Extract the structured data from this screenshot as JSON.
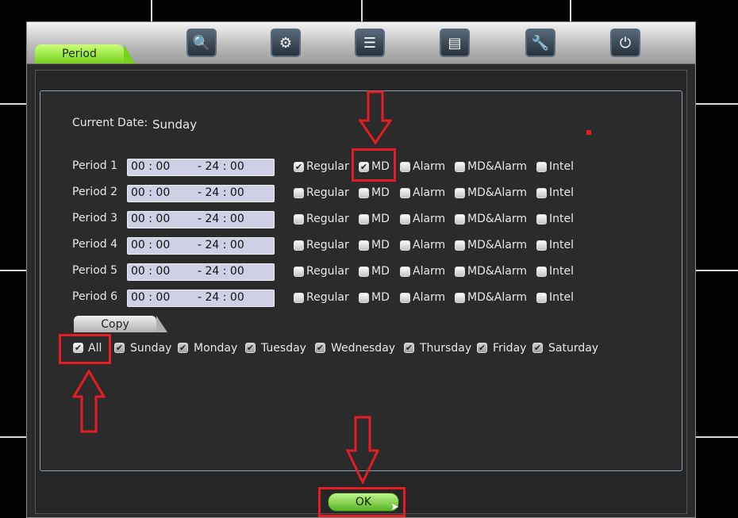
{
  "tab_title": "Period",
  "toolbar_icons": [
    "search-icon",
    "camera-settings-icon",
    "list-icon",
    "disk-icon",
    "wrench-icon",
    "power-icon"
  ],
  "current_date": {
    "label": "Current Date:",
    "value": "Sunday"
  },
  "periods": [
    {
      "label": "Period 1",
      "start": "00 : 00",
      "end": "- 24 : 00",
      "regular": true,
      "md": true,
      "alarm": false,
      "md_alarm": false,
      "intel": false
    },
    {
      "label": "Period 2",
      "start": "00 : 00",
      "end": "- 24 : 00",
      "regular": false,
      "md": false,
      "alarm": false,
      "md_alarm": false,
      "intel": false
    },
    {
      "label": "Period 3",
      "start": "00 : 00",
      "end": "- 24 : 00",
      "regular": false,
      "md": false,
      "alarm": false,
      "md_alarm": false,
      "intel": false
    },
    {
      "label": "Period 4",
      "start": "00 : 00",
      "end": "- 24 : 00",
      "regular": false,
      "md": false,
      "alarm": false,
      "md_alarm": false,
      "intel": false
    },
    {
      "label": "Period 5",
      "start": "00 : 00",
      "end": "- 24 : 00",
      "regular": false,
      "md": false,
      "alarm": false,
      "md_alarm": false,
      "intel": false
    },
    {
      "label": "Period 6",
      "start": "00 : 00",
      "end": "- 24 : 00",
      "regular": false,
      "md": false,
      "alarm": false,
      "md_alarm": false,
      "intel": false
    }
  ],
  "options": {
    "regular": "Regular",
    "md": "MD",
    "alarm": "Alarm",
    "md_alarm": "MD&Alarm",
    "intel": "Intel"
  },
  "copy": {
    "label": "Copy",
    "all": "All",
    "days": [
      "Sunday",
      "Monday",
      "Tuesday",
      "Wednesday",
      "Thursday",
      "Friday",
      "Saturday"
    ]
  },
  "ok_label": "OK",
  "colors": {
    "annotation": "#e41c24",
    "ok_green": "#56b323",
    "tab_green": "#76d21c"
  }
}
